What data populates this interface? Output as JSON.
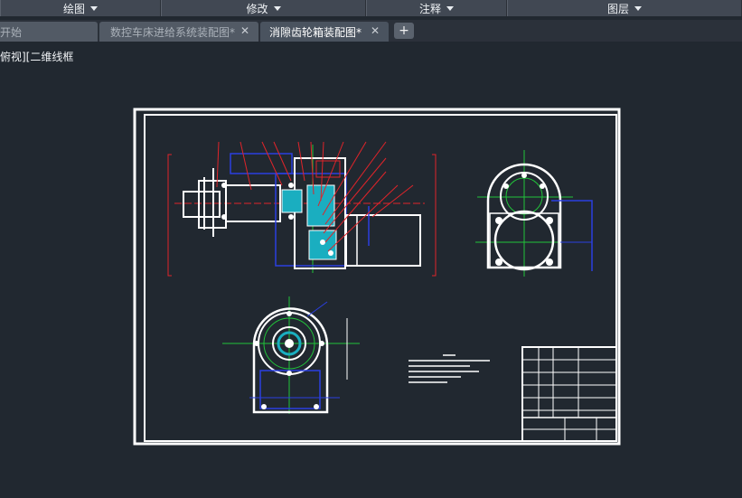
{
  "ribbon": {
    "panels": [
      {
        "label": "绘图"
      },
      {
        "label": "修改"
      },
      {
        "label": "注释"
      },
      {
        "label": "图层"
      }
    ]
  },
  "tabs": [
    {
      "label": "开始"
    },
    {
      "label": "数控车床进给系统装配图*"
    },
    {
      "label": "消隙齿轮箱装配图*"
    }
  ],
  "tab_close_glyph": "✕",
  "new_tab_glyph": "+",
  "viewport": {
    "label": "俯视][二维线框"
  },
  "colors": {
    "background": "#212830",
    "ribbon": "#414853",
    "line_white": "#ffffff",
    "line_red": "#e0242a",
    "line_blue": "#2a3fe0",
    "line_green": "#21c33a",
    "fill_cyan": "#1aaec0"
  }
}
